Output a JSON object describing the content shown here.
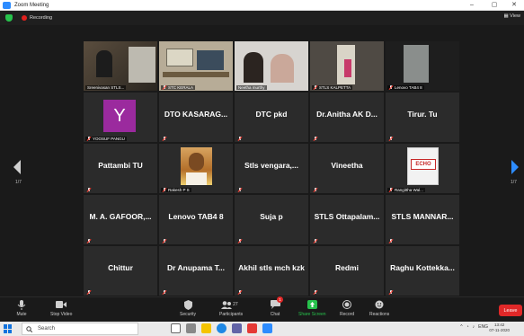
{
  "window": {
    "title": "Zoom Meeting",
    "controls": [
      "–",
      "▢",
      "✕"
    ]
  },
  "infobar": {
    "recording_label": "Recording",
    "view_label": "View"
  },
  "pagination": {
    "left_page": "1/7",
    "right_page": "1/7"
  },
  "tiles": [
    {
      "name": "Sreenivasan STLS...",
      "type": "video",
      "scene": "dark-room",
      "muted": false
    },
    {
      "name": "STC KERALA",
      "type": "video",
      "scene": "office",
      "muted": true,
      "active": true
    },
    {
      "name": "Neetha murthy",
      "type": "video",
      "scene": "bright-people",
      "muted": false
    },
    {
      "name": "STLS KALPETTA",
      "type": "video",
      "scene": "doorway",
      "muted": true
    },
    {
      "name": "Lenovo TAB4 8",
      "type": "video",
      "scene": "dark-door",
      "muted": true
    },
    {
      "name": "YOOSUF PANGU",
      "type": "avatar",
      "avatar_letter": "Y",
      "muted": true
    },
    {
      "name": "DTO  KASARAG...",
      "type": "text",
      "muted": true
    },
    {
      "name": "DTC pkd",
      "type": "text",
      "muted": true
    },
    {
      "name": "Dr.Anitha AK D...",
      "type": "text",
      "muted": true
    },
    {
      "name": "Tirur. Tu",
      "type": "text",
      "muted": true
    },
    {
      "name": "Pattambi TU",
      "type": "text",
      "muted": true
    },
    {
      "name": "Rakesh P S",
      "type": "photo",
      "muted": true
    },
    {
      "name": "Stls   vengara,...",
      "type": "text",
      "muted": true
    },
    {
      "name": "Vineetha",
      "type": "text",
      "muted": true
    },
    {
      "name": "Rangittha Wal...",
      "type": "echo",
      "logo_text": "ECHO",
      "muted": true
    },
    {
      "name": "M. A. GAFOOR,...",
      "type": "text",
      "muted": true
    },
    {
      "name": "Lenovo TAB4 8",
      "type": "text",
      "muted": true
    },
    {
      "name": "Suja p",
      "type": "text",
      "muted": true
    },
    {
      "name": "STLS  Ottapalam...",
      "type": "text",
      "muted": true
    },
    {
      "name": "STLS  MANNAR...",
      "type": "text",
      "muted": true
    },
    {
      "name": "Chittur",
      "type": "text",
      "muted": true
    },
    {
      "name": "Dr Anupama T...",
      "type": "text",
      "muted": true
    },
    {
      "name": "Akhil stls mch kzk",
      "type": "text",
      "muted": true
    },
    {
      "name": "Redmi",
      "type": "text",
      "muted": true
    },
    {
      "name": "Raghu  Kottekka...",
      "type": "text",
      "muted": true
    }
  ],
  "toolbar": {
    "mute": "Mute",
    "stop_video": "Stop Video",
    "security": "Security",
    "participants": "Participants",
    "participant_count": "27",
    "chat": "Chat",
    "chat_badge": "1",
    "share_screen": "Share Screen",
    "record": "Record",
    "reactions": "Reactions",
    "leave": "Leave"
  },
  "taskbar": {
    "search_placeholder": "Search",
    "lang": "ENG",
    "time": "13:42",
    "date": "07-11-2020"
  },
  "colors": {
    "active_speaker": "#c7e02a",
    "leave": "#e02828",
    "share_screen": "#27c24c",
    "recording": "#e0201d",
    "avatar": "#9b2a9e"
  }
}
